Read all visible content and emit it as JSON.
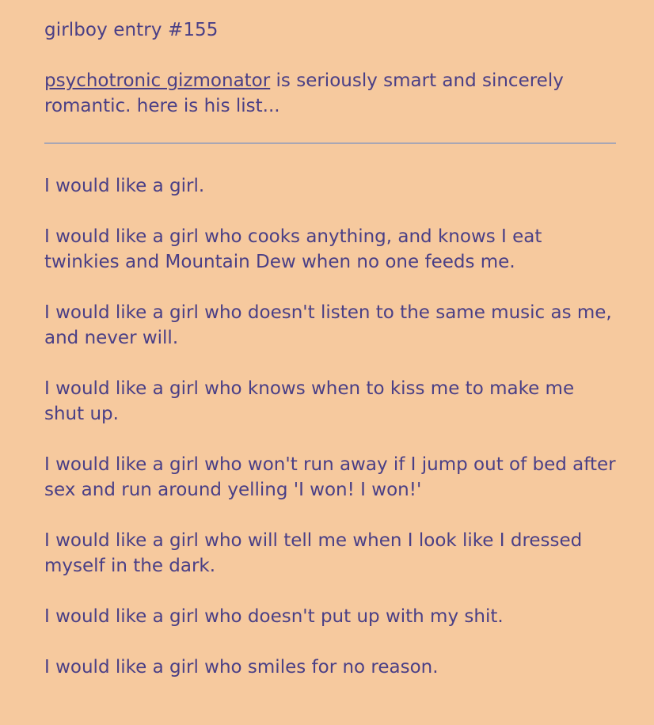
{
  "entry": {
    "title": "girlboy entry #155"
  },
  "intro": {
    "author_link": "psychotronic gizmonator",
    "text": " is seriously smart and sincerely romantic. here is his list..."
  },
  "list": {
    "items": [
      "I would like a girl.",
      "I would like a girl who cooks anything, and knows I eat twinkies and Mountain Dew when no one feeds me.",
      "I would like a girl who doesn't listen to the same music as me, and never will.",
      "I would like a girl who knows when to kiss me to make me shut up.",
      "I would like a girl who won't run away if I jump out of bed after sex and run around yelling 'I won! I won!'",
      "I would like a girl who will tell me when I look like I dressed myself in the dark.",
      "I would like a girl who doesn't put up with my shit.",
      "I would like a girl who smiles for no reason."
    ]
  },
  "colors": {
    "background": "#f6c99e",
    "text": "#4a3f86",
    "divider": "#a8a6b4"
  }
}
